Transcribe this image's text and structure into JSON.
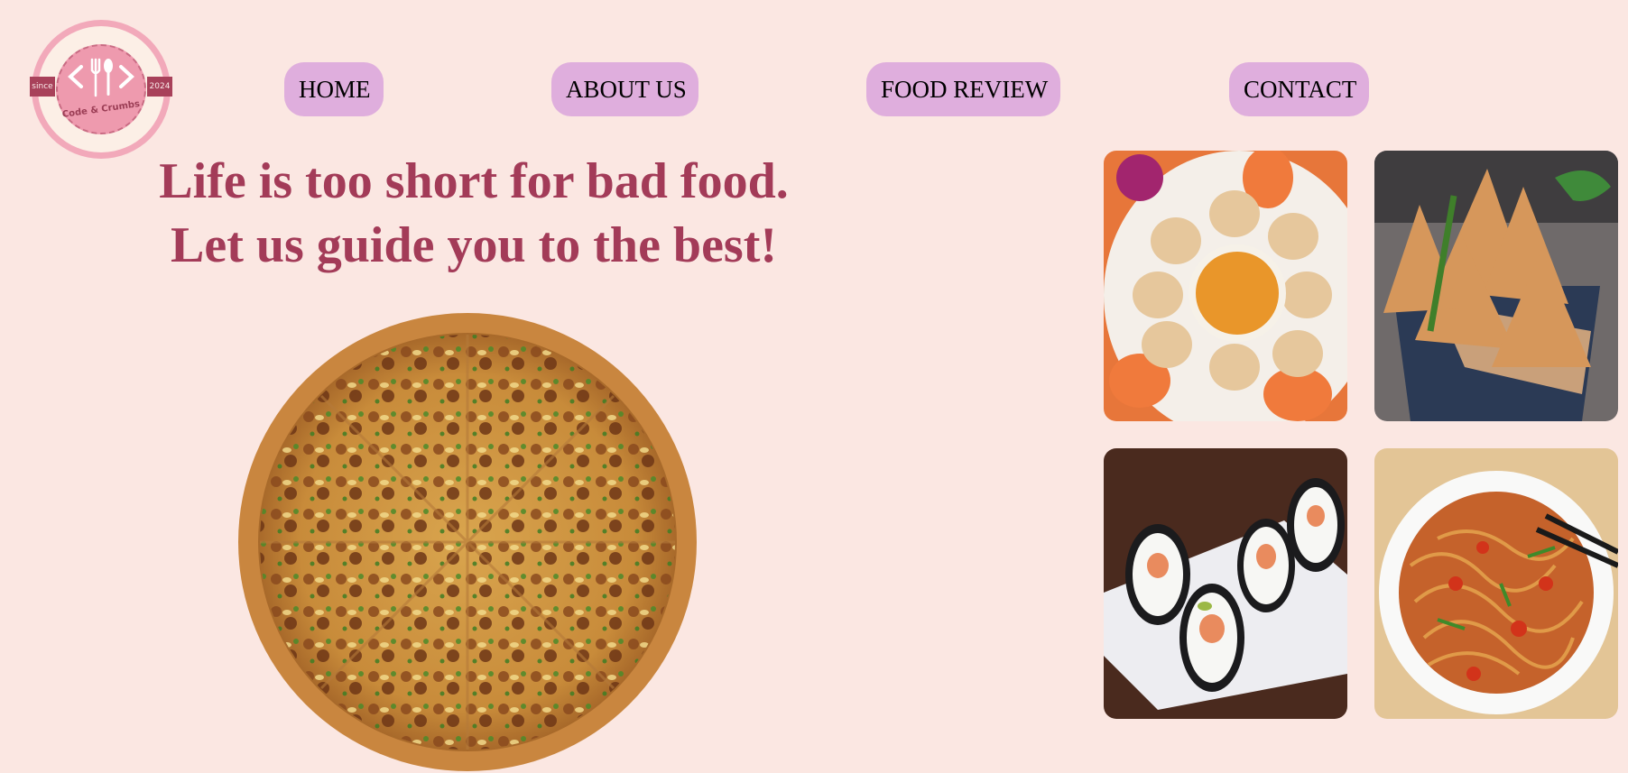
{
  "logo": {
    "since_label": "since",
    "year_label": "2024",
    "brand_text": "Code & Crumbs"
  },
  "nav": {
    "items": [
      {
        "label": "HOME"
      },
      {
        "label": "ABOUT US"
      },
      {
        "label": "FOOD REVIEW"
      },
      {
        "label": "CONTACT"
      }
    ]
  },
  "hero": {
    "line1": "Life is too short for bad food.",
    "line2": "Let us guide you to the best!"
  },
  "gallery": {
    "icons": [
      "momos-plate",
      "samosa-basket",
      "sushi-rolls",
      "noodles-bowl"
    ]
  },
  "colors": {
    "background": "#fbe7e2",
    "nav_button": "#dfaedd",
    "heading": "#a33b58",
    "logo_pink": "#f2a9ba",
    "logo_ribbon": "#a8415a"
  }
}
